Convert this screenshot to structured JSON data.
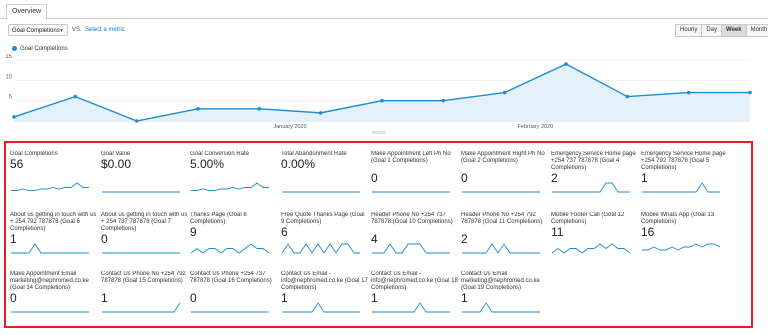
{
  "tabs": [
    "Overview"
  ],
  "controls": {
    "metric_select": "Goal Completions",
    "vs": "VS.",
    "select_metric": "Select a metric",
    "granularity": [
      "Hourly",
      "Day",
      "Week",
      "Month"
    ],
    "granularity_active": "Week"
  },
  "colors": {
    "series": "#1f8ccf",
    "fill": "#e4f1fa",
    "highlight": "#e21e1e"
  },
  "chart_data": {
    "type": "line",
    "series": [
      {
        "name": "Goal Completions",
        "values": [
          1,
          6,
          0,
          3,
          3,
          2,
          5,
          5,
          7,
          14,
          6,
          7,
          7
        ]
      }
    ],
    "y_ticks": [
      "5",
      "10",
      "15"
    ],
    "ylim": [
      0,
      15
    ],
    "x_labels": [
      "January 2020",
      "February 2020"
    ],
    "grid": true
  },
  "cards": [
    {
      "title": "Goal Completions",
      "value": "56",
      "spark": [
        1,
        1,
        2,
        1,
        1,
        2,
        2,
        3,
        2,
        3,
        3,
        6,
        3,
        3
      ]
    },
    {
      "title": "Goal Value",
      "value": "$0.00",
      "spark": [
        0,
        0,
        0,
        0,
        0,
        0,
        0,
        0,
        0,
        0,
        0,
        0,
        0,
        0
      ]
    },
    {
      "title": "Goal Conversion Rate",
      "value": "5.00%",
      "spark": [
        1,
        1,
        2,
        1,
        1,
        2,
        2,
        3,
        2,
        3,
        3,
        6,
        3,
        3
      ]
    },
    {
      "title": "Total Abandonment Rate",
      "value": "0.00%",
      "spark": [
        0,
        0,
        0,
        0,
        0,
        0,
        0,
        0,
        0,
        0,
        0,
        0,
        0,
        0
      ]
    },
    {
      "title": "Make Appointment Left Ph No (Goal 1 Completions)",
      "value": "0",
      "spark": [
        0,
        0,
        0,
        0,
        0,
        0,
        0,
        0,
        0,
        0,
        0,
        0,
        0,
        0
      ]
    },
    {
      "title": "Make Appointment Right Ph No (Goal 2 Completions)",
      "value": "0",
      "spark": [
        0,
        0,
        0,
        0,
        0,
        0,
        0,
        0,
        0,
        0,
        0,
        0,
        0,
        0
      ]
    },
    {
      "title": "Emergency Service Home page +254 737 787878 (Goal 4 Completions)",
      "value": "2",
      "spark": [
        0,
        0,
        0,
        0,
        0,
        0,
        0,
        0,
        0,
        1,
        1,
        0,
        0,
        0
      ]
    },
    {
      "title": "Emergency Service Home page +254 792 787878 (Goal 5 Completions)",
      "value": "1",
      "spark": [
        0,
        0,
        0,
        0,
        0,
        0,
        0,
        0,
        0,
        0,
        1,
        0,
        0,
        0
      ]
    },
    {
      "title": "About us getting in touch with us + 254 792 787878 (Goal 6 Completions)",
      "value": "1",
      "spark": [
        0,
        0,
        0,
        0,
        1,
        0,
        0,
        0,
        0,
        0,
        0,
        0,
        0,
        0
      ]
    },
    {
      "title": "About us getting in touch with us + 254 737 787878 (Goal 7 Completions)",
      "value": "0",
      "spark": [
        0,
        0,
        0,
        0,
        0,
        0,
        0,
        0,
        0,
        0,
        0,
        0,
        0,
        0
      ]
    },
    {
      "title": "Thanks Page (Goal 8 Completions)",
      "value": "9",
      "spark": [
        0,
        1,
        0,
        1,
        1,
        0,
        1,
        1,
        0,
        1,
        2,
        1,
        1,
        0
      ]
    },
    {
      "title": "Free Quote Thanks Page (Goal 9 Completions)",
      "value": "6",
      "spark": [
        0,
        1,
        0,
        0,
        1,
        0,
        1,
        0,
        1,
        0,
        1,
        1,
        0,
        0
      ]
    },
    {
      "title": "Header Phone No +254 737 787878 (Goal 10 Completions)",
      "value": "4",
      "spark": [
        0,
        0,
        0,
        1,
        0,
        0,
        1,
        1,
        1,
        0,
        0,
        0,
        0,
        0
      ]
    },
    {
      "title": "Header Phone No +254 792 787878 (Goal 11 Completions)",
      "value": "2",
      "spark": [
        0,
        0,
        0,
        0,
        0,
        1,
        0,
        1,
        0,
        0,
        0,
        0,
        0,
        0
      ]
    },
    {
      "title": "Mobile Footer Call (Goal 12 Completions)",
      "value": "11",
      "spark": [
        0,
        1,
        0,
        1,
        1,
        0,
        1,
        1,
        2,
        1,
        2,
        1,
        1,
        0
      ]
    },
    {
      "title": "Mobile Whats App (Goal 13 Completions)",
      "value": "16",
      "spark": [
        1,
        1,
        2,
        1,
        1,
        2,
        1,
        2,
        2,
        3,
        2,
        3,
        3,
        2
      ]
    },
    {
      "title": "Make Appointment Email marketing@nephromed.co.ke (Goal 14 Completions)",
      "value": "0",
      "spark": [
        0,
        0,
        0,
        0,
        0,
        0,
        0,
        0,
        0,
        0,
        0,
        0,
        0,
        0
      ]
    },
    {
      "title": "Contact Us Phone No +254 792 787878 (Goal 15 Completions)",
      "value": "1",
      "spark": [
        0,
        0,
        0,
        0,
        0,
        0,
        0,
        0,
        0,
        0,
        0,
        0,
        0,
        1
      ]
    },
    {
      "title": "Contact Us Phone +254 737 787878 (Goal 16 Completions)",
      "value": "0",
      "spark": [
        0,
        0,
        0,
        0,
        0,
        0,
        0,
        0,
        0,
        0,
        0,
        0,
        0,
        0
      ]
    },
    {
      "title": "Contact Us Email - info@nephromed.co.ke (Goal 17 Completions)",
      "value": "1",
      "spark": [
        0,
        0,
        0,
        0,
        0,
        0,
        1,
        0,
        0,
        0,
        0,
        0,
        0,
        0
      ]
    },
    {
      "title": "Contact Us Email - info@nephromed.co.ke (Goal 18 Completions)",
      "value": "1",
      "spark": [
        0,
        0,
        0,
        0,
        0,
        0,
        0,
        0,
        1,
        0,
        0,
        0,
        0,
        0
      ]
    },
    {
      "title": "Contact Us Email marketing@nephromed.co.ke (Goal 19 Completions)",
      "value": "1",
      "spark": [
        0,
        0,
        0,
        0,
        1,
        0,
        0,
        0,
        0,
        0,
        0,
        0,
        0,
        0
      ]
    }
  ]
}
